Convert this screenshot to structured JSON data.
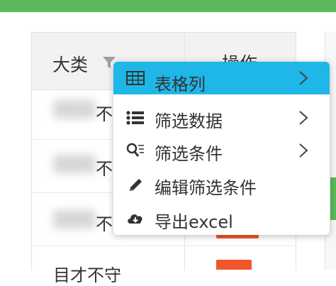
{
  "table": {
    "headers": {
      "category": "大类",
      "action": "操作"
    },
    "rows": [
      {
        "category": "不",
        "visible_char": "不"
      },
      {
        "category": "不",
        "visible_char": "不"
      },
      {
        "category": "不",
        "visible_char": "不"
      },
      {
        "category": "目才不守"
      }
    ]
  },
  "context_menu": {
    "items": [
      {
        "label": "表格列",
        "icon": "table-icon",
        "has_submenu": true,
        "active": true
      },
      {
        "label": "筛选数据",
        "icon": "list-icon",
        "has_submenu": true,
        "active": false
      },
      {
        "label": "筛选条件",
        "icon": "search-filter-icon",
        "has_submenu": true,
        "active": false
      },
      {
        "label": "编辑筛选条件",
        "icon": "pencil-icon",
        "has_submenu": false,
        "active": false
      },
      {
        "label": "导出excel",
        "icon": "cloud-download-icon",
        "has_submenu": false,
        "active": false
      }
    ]
  },
  "colors": {
    "accent": "#1fb6e8",
    "topbar": "#5cb85c",
    "badge": "#f0572b"
  }
}
